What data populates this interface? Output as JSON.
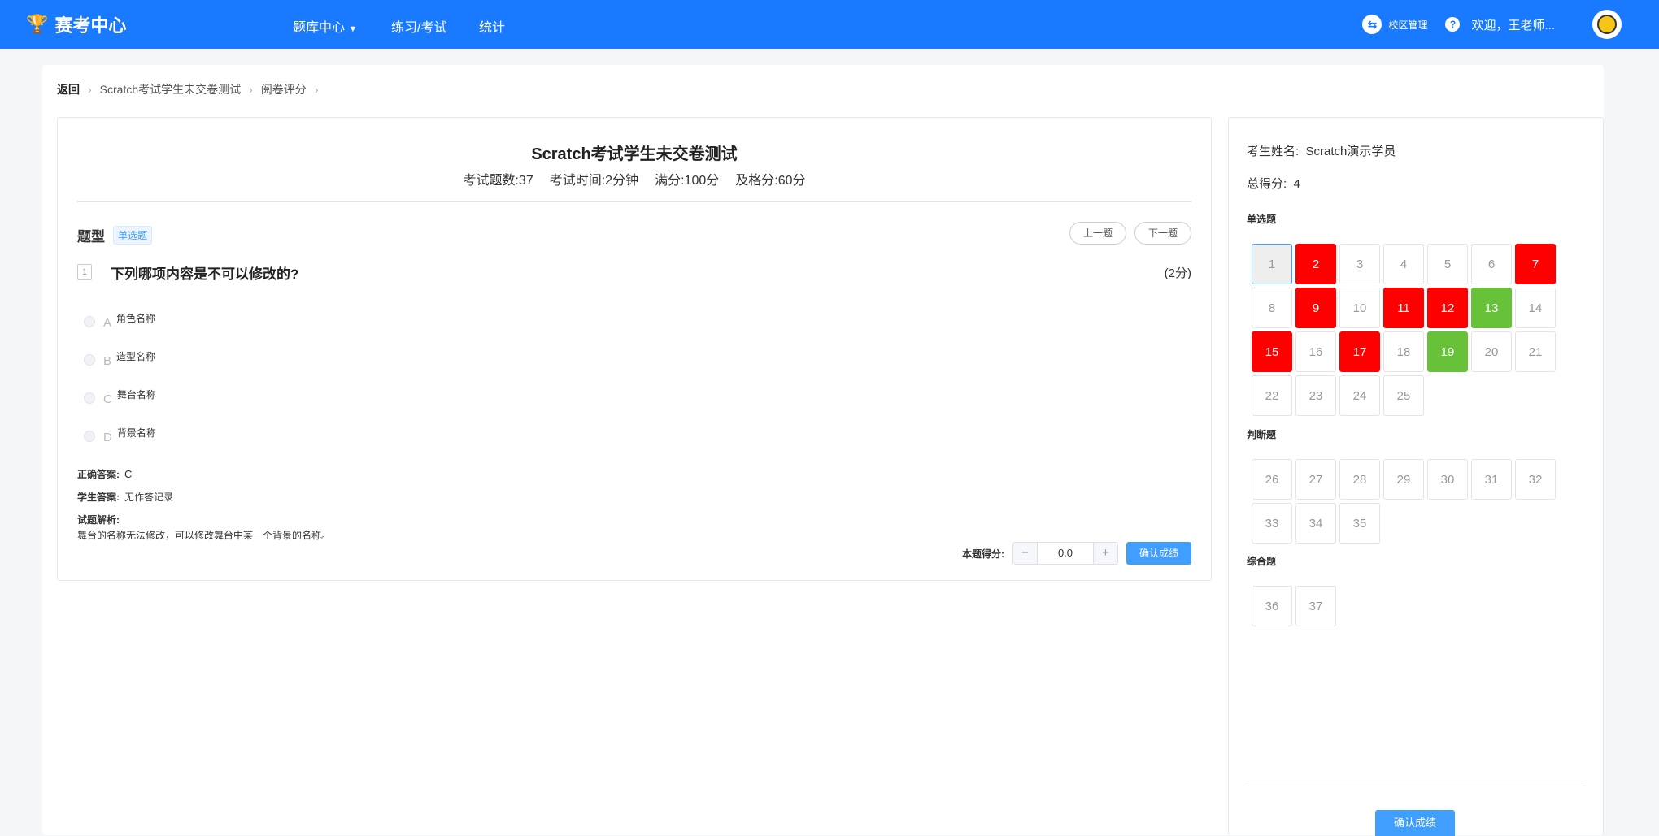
{
  "header": {
    "logo": "赛考中心",
    "nav": [
      "题库中心",
      "练习/考试",
      "统计"
    ],
    "campus": "校区管理",
    "welcome": "欢迎，王老师..."
  },
  "breadcrumb": [
    "返回",
    "Scratch考试学生未交卷测试",
    "阅卷评分"
  ],
  "exam": {
    "title": "Scratch考试学生未交卷测试",
    "count": "考试题数:37",
    "time": "考试时间:2分钟",
    "full": "满分:100分",
    "pass": "及格分:60分"
  },
  "question": {
    "type_label": "题型",
    "type": "单选题",
    "prev": "上一题",
    "next": "下一题",
    "number": "1",
    "text": "下列哪项内容是不可以修改的?",
    "points": "(2分)",
    "options": [
      {
        "letter": "A",
        "text": "角色名称"
      },
      {
        "letter": "B",
        "text": "造型名称"
      },
      {
        "letter": "C",
        "text": "舞台名称"
      },
      {
        "letter": "D",
        "text": "背景名称"
      }
    ],
    "correct_label": "正确答案:",
    "correct": "C",
    "student_label": "学生答案:",
    "student": "无作答记录",
    "analysis_label": "试题解析:",
    "analysis": "舞台的名称无法修改，可以修改舞台中某一个背景的名称。",
    "score_label": "本题得分:",
    "score": "0.0",
    "confirm": "确认成绩"
  },
  "side": {
    "name_label": "考生姓名:",
    "name": "Scratch演示学员",
    "total_label": "总得分:",
    "total": "4",
    "confirm": "确认成绩",
    "sections": [
      {
        "title": "单选题",
        "items": [
          [
            "1",
            "cur"
          ],
          [
            "2",
            "wrong"
          ],
          [
            "3",
            ""
          ],
          [
            "4",
            ""
          ],
          [
            "5",
            ""
          ],
          [
            "6",
            ""
          ],
          [
            "7",
            "wrong"
          ],
          [
            "8",
            ""
          ],
          [
            "9",
            "wrong"
          ],
          [
            "10",
            ""
          ],
          [
            "11",
            "wrong"
          ],
          [
            "12",
            "wrong"
          ],
          [
            "13",
            "right"
          ],
          [
            "14",
            ""
          ],
          [
            "15",
            "wrong"
          ],
          [
            "16",
            ""
          ],
          [
            "17",
            "wrong"
          ],
          [
            "18",
            ""
          ],
          [
            "19",
            "right"
          ],
          [
            "20",
            ""
          ],
          [
            "21",
            ""
          ],
          [
            "22",
            ""
          ],
          [
            "23",
            ""
          ],
          [
            "24",
            ""
          ],
          [
            "25",
            ""
          ]
        ]
      },
      {
        "title": "判断题",
        "items": [
          [
            "26",
            ""
          ],
          [
            "27",
            ""
          ],
          [
            "28",
            ""
          ],
          [
            "29",
            ""
          ],
          [
            "30",
            ""
          ],
          [
            "31",
            ""
          ],
          [
            "32",
            ""
          ],
          [
            "33",
            ""
          ],
          [
            "34",
            ""
          ],
          [
            "35",
            ""
          ]
        ]
      },
      {
        "title": "综合题",
        "items": [
          [
            "36",
            ""
          ],
          [
            "37",
            ""
          ]
        ]
      }
    ]
  }
}
